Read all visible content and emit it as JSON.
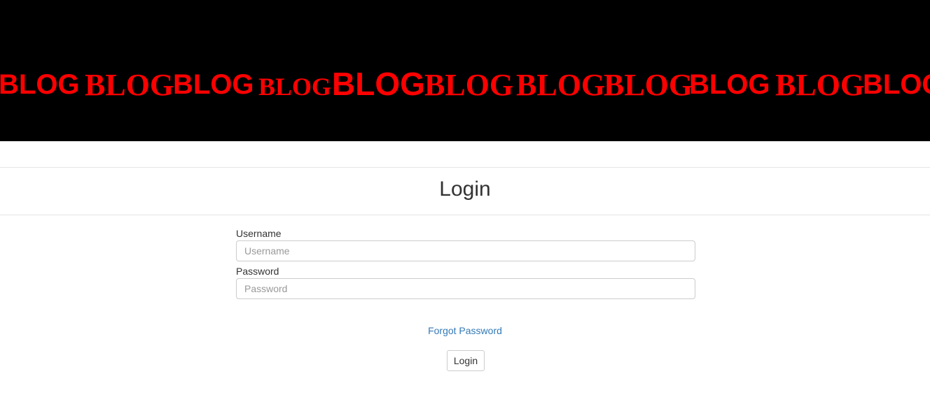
{
  "banner": {
    "background": "#000000",
    "text_color": "#ff0000",
    "words": [
      "BLOG",
      "BLOG",
      "BLOG",
      "BLOG",
      "BLOG",
      "BLOG",
      "BLOG",
      "BLOG",
      "BLOG",
      "BLOG",
      "BLOG"
    ]
  },
  "page": {
    "title": "Login"
  },
  "form": {
    "username_label": "Username",
    "username_placeholder": "Username",
    "username_value": "",
    "password_label": "Password",
    "password_placeholder": "Password",
    "password_value": "",
    "forgot_password": "Forgot Password",
    "login_button": "Login",
    "link_color": "#337ab7"
  }
}
